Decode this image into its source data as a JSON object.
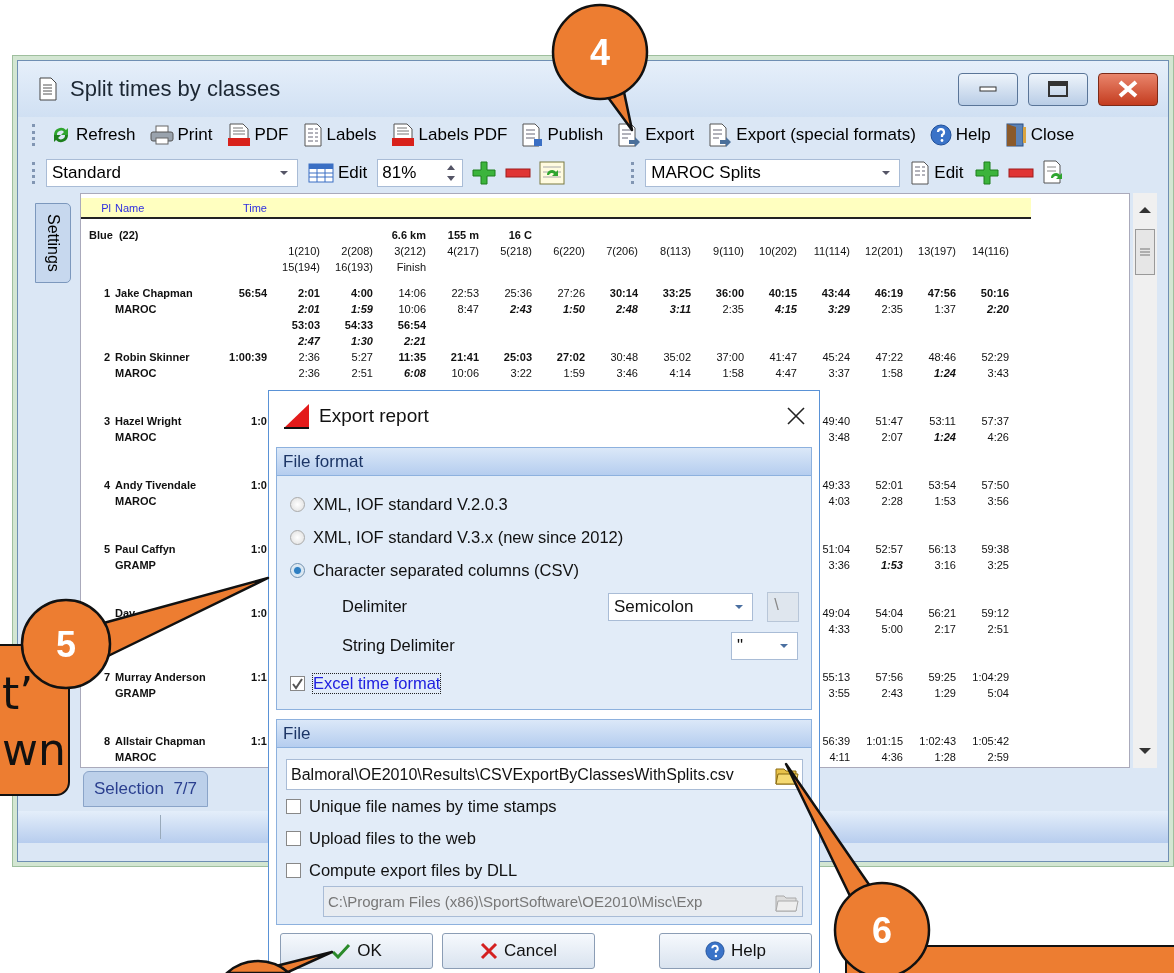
{
  "window": {
    "title": "Split times by classes"
  },
  "toolbar": [
    {
      "label": "Refresh",
      "kind": "refresh"
    },
    {
      "label": "Print",
      "kind": "print"
    },
    {
      "label": "PDF",
      "kind": "pdf"
    },
    {
      "label": "Labels",
      "kind": "labels"
    },
    {
      "label": "Labels PDF",
      "kind": "pdf"
    },
    {
      "label": "Publish",
      "kind": "publish"
    },
    {
      "label": "Export",
      "kind": "export"
    },
    {
      "label": "Export (special formats)",
      "kind": "export"
    },
    {
      "label": "Help",
      "kind": "help"
    },
    {
      "label": "Close",
      "kind": "close"
    }
  ],
  "format_bar": {
    "layout": "Standard",
    "edit": "Edit",
    "zoom": "81%",
    "splits_layout": "MAROC Splits",
    "splits_edit": "Edit"
  },
  "settings_tab": {
    "label": "Settings"
  },
  "table": {
    "columns": [
      "Pl",
      "Name",
      "Time"
    ],
    "class_name": "Blue  (22)",
    "course": [
      "6.6 km",
      "155 m",
      "16 C"
    ],
    "controls": [
      "1(210)",
      "2(208)",
      "3(212)",
      "4(217)",
      "5(218)",
      "6(220)",
      "7(206)",
      "8(113)",
      "9(110)",
      "10(202)",
      "11(114)",
      "12(201)",
      "13(197)",
      "14(116)"
    ],
    "controls_2": [
      "15(194)",
      "16(193)",
      "Finish"
    ],
    "rows": [
      {
        "place": "1",
        "name": "Jake Chapman",
        "club": "MAROC",
        "time": "56:54",
        "splits": [
          [
            "2:01",
            "2:01",
            "53:03",
            "2:47"
          ],
          [
            "4:00",
            "1:59",
            "54:33",
            "1:30"
          ],
          [
            "14:06",
            "10:06",
            "56:54",
            "2:21"
          ],
          [
            "22:53",
            "8:47"
          ],
          [
            "25:36",
            "2:43"
          ],
          [
            "27:26",
            "1:50"
          ],
          [
            "30:14",
            "2:48"
          ],
          [
            "33:25",
            "3:11"
          ],
          [
            "36:00",
            "2:35"
          ],
          [
            "40:15",
            "4:15"
          ],
          [
            "43:44",
            "3:29"
          ],
          [
            "46:19",
            "2:35"
          ],
          [
            "47:56",
            "1:37"
          ],
          [
            "50:16",
            "2:20"
          ]
        ],
        "bold": [
          [
            true,
            true,
            true,
            true
          ],
          [
            true,
            true,
            true,
            true
          ],
          [
            false,
            false,
            true,
            true
          ],
          [
            false,
            false
          ],
          [
            false,
            true
          ],
          [
            false,
            true
          ],
          [
            true,
            true
          ],
          [
            true,
            true
          ],
          [
            true,
            false
          ],
          [
            true,
            true
          ],
          [
            true,
            true
          ],
          [
            true,
            false
          ],
          [
            true,
            false
          ],
          [
            true,
            true
          ]
        ]
      },
      {
        "place": "2",
        "name": "Robin Skinner",
        "club": "MAROC",
        "time": "1:00:39",
        "splits": [
          [
            "2:36",
            "2:36"
          ],
          [
            "5:27",
            "2:51"
          ],
          [
            "11:35",
            "6:08"
          ],
          [
            "21:41",
            "10:06"
          ],
          [
            "25:03",
            "3:22"
          ],
          [
            "27:02",
            "1:59"
          ],
          [
            "30:48",
            "3:46"
          ],
          [
            "35:02",
            "4:14"
          ],
          [
            "37:00",
            "1:58"
          ],
          [
            "41:47",
            "4:47"
          ],
          [
            "45:24",
            "3:37"
          ],
          [
            "47:22",
            "1:58"
          ],
          [
            "48:46",
            "1:24"
          ],
          [
            "52:29",
            "3:43"
          ]
        ],
        "bold": [
          [
            false,
            false
          ],
          [
            false,
            false
          ],
          [
            true,
            true
          ],
          [
            true,
            false
          ],
          [
            true,
            false
          ],
          [
            true,
            false
          ],
          [
            false,
            false
          ],
          [
            false,
            false
          ],
          [
            false,
            false
          ],
          [
            false,
            false
          ],
          [
            false,
            false
          ],
          [
            false,
            false
          ],
          [
            false,
            true
          ],
          [
            false,
            false
          ]
        ]
      },
      {
        "place": "3",
        "name": "Hazel Wright",
        "club": "MAROC",
        "time": "1:0",
        "splits": [
          [
            "49:40",
            "3:48"
          ],
          [
            "51:47",
            "2:07"
          ],
          [
            "53:11",
            "1:24"
          ],
          [
            "57:37",
            "4:26"
          ]
        ],
        "bold": [
          [
            false,
            false
          ],
          [
            false,
            false
          ],
          [
            false,
            true
          ],
          [
            false,
            false
          ]
        ]
      },
      {
        "place": "4",
        "name": "Andy Tivendale",
        "club": "MAROC",
        "time": "1:0",
        "splits": [
          [
            "49:33",
            "4:03"
          ],
          [
            "52:01",
            "2:28"
          ],
          [
            "53:54",
            "1:53"
          ],
          [
            "57:50",
            "3:56"
          ]
        ],
        "bold": [
          [
            false,
            false
          ],
          [
            false,
            false
          ],
          [
            false,
            false
          ],
          [
            false,
            false
          ]
        ]
      },
      {
        "place": "5",
        "name": "Paul Caffyn",
        "club": "GRAMP",
        "time": "1:0",
        "splits": [
          [
            "51:04",
            "3:36"
          ],
          [
            "52:57",
            "1:53"
          ],
          [
            "56:13",
            "3:16"
          ],
          [
            "59:38",
            "3:25"
          ]
        ],
        "bold": [
          [
            false,
            false
          ],
          [
            false,
            true
          ],
          [
            false,
            false
          ],
          [
            false,
            false
          ]
        ]
      },
      {
        "name": "Dav",
        "time": "1:0",
        "splits": [
          [
            "49:04",
            "4:33"
          ],
          [
            "54:04",
            "5:00"
          ],
          [
            "56:21",
            "2:17"
          ],
          [
            "59:12",
            "2:51"
          ]
        ],
        "bold": [
          [
            false,
            false
          ],
          [
            false,
            false
          ],
          [
            false,
            false
          ],
          [
            false,
            false
          ]
        ]
      },
      {
        "place": "7",
        "name": "Murray Anderson",
        "club": "GRAMP",
        "time": "1:1",
        "splits": [
          [
            "55:13",
            "3:55"
          ],
          [
            "57:56",
            "2:43"
          ],
          [
            "59:25",
            "1:29"
          ],
          [
            "1:04:29",
            "5:04"
          ]
        ],
        "bold": [
          [
            false,
            false
          ],
          [
            false,
            false
          ],
          [
            false,
            false
          ],
          [
            false,
            false
          ]
        ]
      },
      {
        "place": "8",
        "name": "Allstair Chapman",
        "club": "MAROC",
        "time": "1:1",
        "splits": [
          [
            "56:39",
            "4:11"
          ],
          [
            "1:01:15",
            "4:36"
          ],
          [
            "1:02:43",
            "1:28"
          ],
          [
            "1:05:42",
            "2:59"
          ]
        ],
        "bold": [
          [
            false,
            false
          ],
          [
            false,
            false
          ],
          [
            false,
            false
          ],
          [
            false,
            false
          ]
        ]
      }
    ]
  },
  "bottom_tabs": [
    {
      "label": "Selection  7/7",
      "selected": true
    }
  ],
  "dialog": {
    "title": "Export report",
    "format_group": {
      "title": "File format",
      "options": [
        {
          "label": "XML, IOF standard V.2.0.3",
          "selected": false
        },
        {
          "label": "XML, IOF standard V.3.x (new since 2012)",
          "selected": false
        },
        {
          "label": "Character separated columns (CSV)",
          "selected": true
        }
      ],
      "delimiter": {
        "label": "Delimiter",
        "value": "Semicolon"
      },
      "custom_delimiter": {
        "value": "\\",
        "disabled": true
      },
      "string_delimiter": {
        "label": "String Delimiter",
        "value": "\""
      },
      "excel_time": {
        "label": "Excel time format",
        "checked": true,
        "focused": true
      }
    },
    "file_group": {
      "title": "File",
      "path": "Balmoral\\OE2010\\Results\\CSVExportByClassesWithSplits.csv",
      "options": [
        {
          "label": "Unique file names by time stamps",
          "checked": false
        },
        {
          "label": "Upload files to the web",
          "checked": false
        },
        {
          "label": "Compute export files by DLL",
          "checked": false
        }
      ],
      "dll_path": {
        "value": "C:\\Program Files (x86)\\SportSoftware\\OE2010\\Misc\\Exp",
        "disabled": true
      }
    },
    "buttons": [
      {
        "label": "OK",
        "kind": "ok"
      },
      {
        "label": "Cancel",
        "kind": "cancel"
      },
      {
        "label": "Help",
        "kind": "help"
      }
    ]
  },
  "callouts": [
    {
      "number": "4"
    },
    {
      "number": "5"
    },
    {
      "number": "6"
    }
  ],
  "callout_note": {
    "lines": [
      "t’",
      "wn"
    ]
  }
}
